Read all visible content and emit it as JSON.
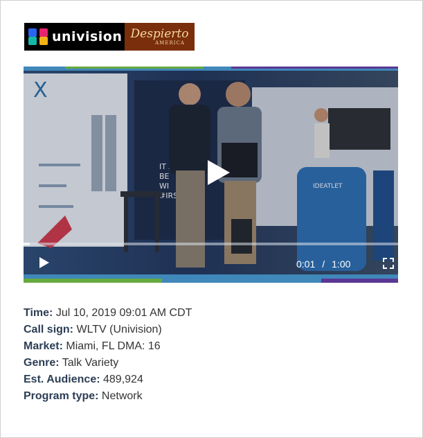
{
  "logos": {
    "univision_text": "univision",
    "despierto_main": "Despierto",
    "despierto_sub": "AMERICA"
  },
  "video": {
    "current_time": "0:01",
    "separator": "/",
    "duration": "1:00",
    "progress": 0.017,
    "icons": [
      "play-icon",
      "play-control-icon",
      "fullscreen-icon"
    ]
  },
  "info": [
    {
      "label": "Time:",
      "value": "Jul 10, 2019 09:01 AM CDT"
    },
    {
      "label": "Call sign:",
      "value": "WLTV (Univision)"
    },
    {
      "label": "Market:",
      "value": "Miami, FL DMA: 16"
    },
    {
      "label": "Genre:",
      "value": "Talk Variety"
    },
    {
      "label": "Est. Audience:",
      "value": "489,924"
    },
    {
      "label": "Program type:",
      "value": "Network"
    }
  ],
  "colors": {
    "label": "#2c3e55",
    "despierto_bg": "#7a2e0c",
    "univision_bg": "#000000"
  }
}
